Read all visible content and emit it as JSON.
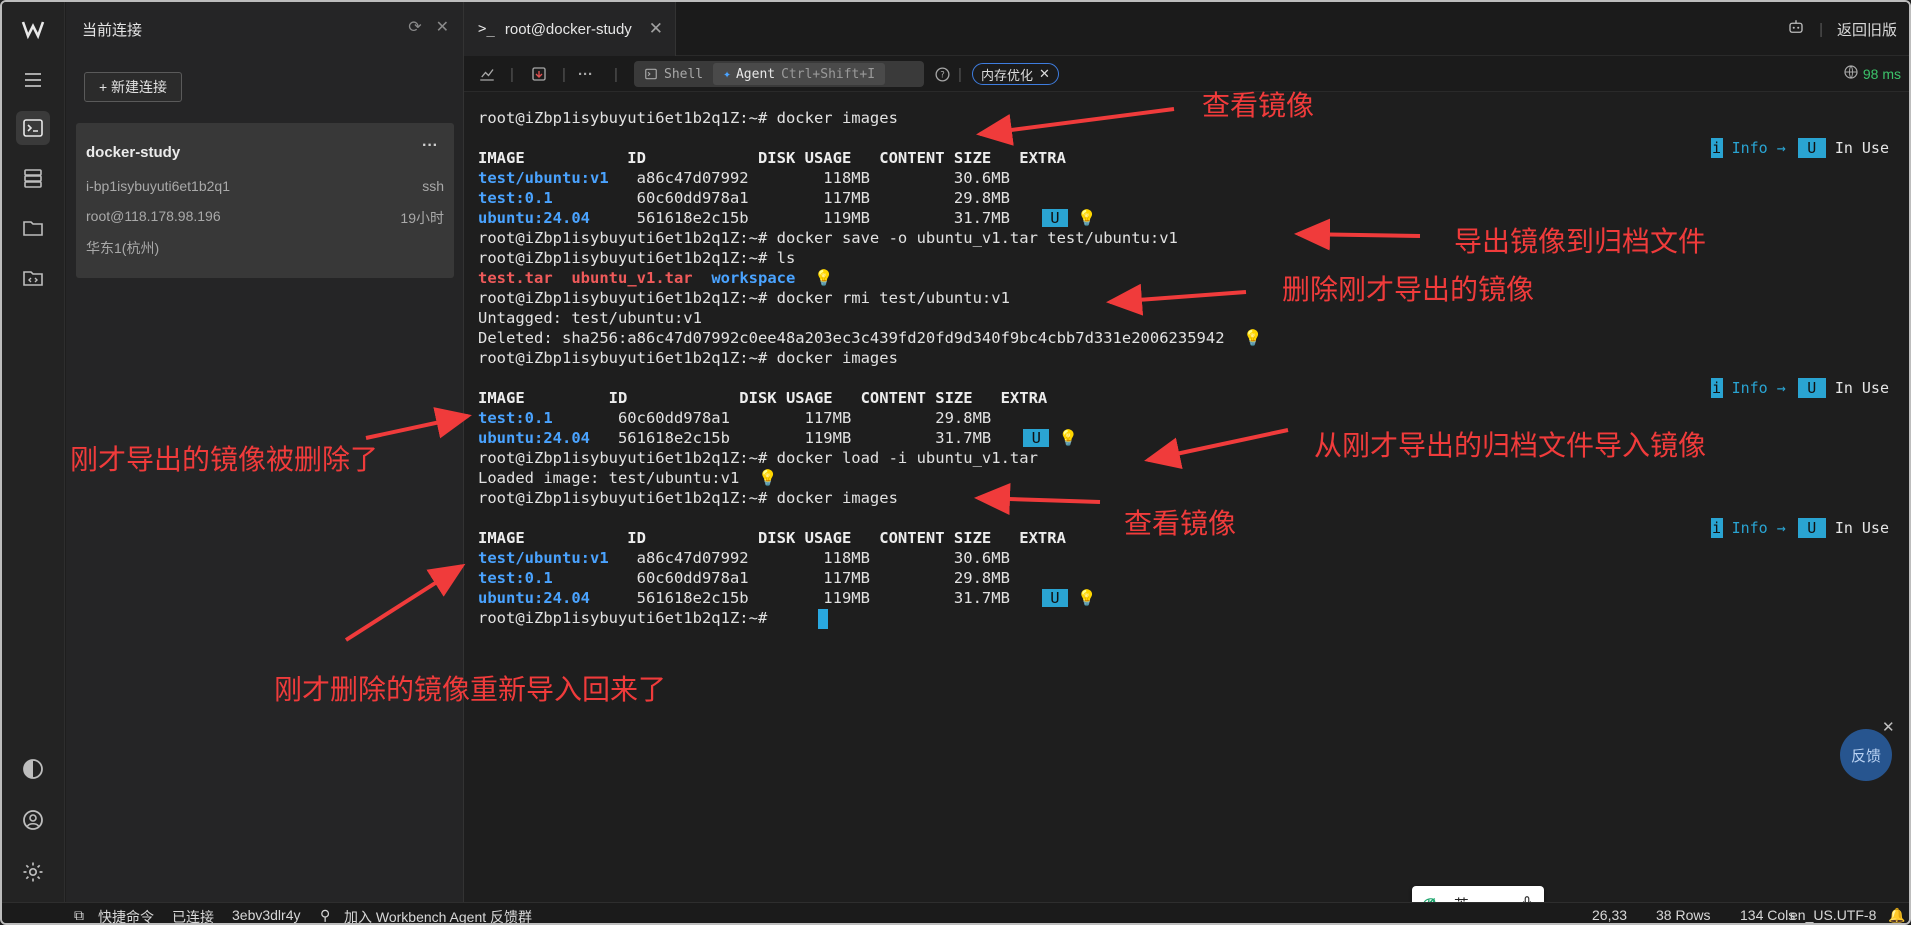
{
  "sidebar": {
    "title": "当前连接",
    "new_connection": "+ 新建连接",
    "card": {
      "name": "docker-study",
      "instance_id": "i-bp1isybuyuti6et1b2q1",
      "protocol": "ssh",
      "user_host": "root@118.178.98.196",
      "last_seen": "19小时",
      "region": "华东1(杭州)"
    }
  },
  "tab": {
    "label": "root@docker-study"
  },
  "top_right": {
    "legacy_link": "返回旧版"
  },
  "toolbar": {
    "shell_label": "Shell",
    "agent_label": "Agent",
    "agent_shortcut": "Ctrl+Shift+I",
    "memory_chip": "内存优化",
    "latency": "98 ms"
  },
  "terminal": {
    "lines": [
      "root@iZbp1isybuyuti6et1b2q1Z:~# docker images",
      "",
      "IMAGE           ID            DISK USAGE   CONTENT SIZE   EXTRA",
      "test/ubuntu:v1   a86c47d07992        118MB         30.6MB",
      "test:0.1         60c60dd978a1        117MB         29.8MB",
      "ubuntu:24.04     561618e2c15b        119MB         31.7MB",
      "root@iZbp1isybuyuti6et1b2q1Z:~# docker save -o ubuntu_v1.tar test/ubuntu:v1",
      "root@iZbp1isybuyuti6et1b2q1Z:~# ls",
      "test.tar  ubuntu_v1.tar  workspace",
      "root@iZbp1isybuyuti6et1b2q1Z:~# docker rmi test/ubuntu:v1",
      "Untagged: test/ubuntu:v1",
      "Deleted: sha256:a86c47d07992c0ee48a203ec3c439fd20fd9d340f9bc4cbb7d331e2006235942",
      "root@iZbp1isybuyuti6et1b2q1Z:~# docker images",
      "",
      "IMAGE         ID            DISK USAGE   CONTENT SIZE   EXTRA",
      "test:0.1       60c60dd978a1        117MB         29.8MB",
      "ubuntu:24.04   561618e2c15b        119MB         31.7MB",
      "root@iZbp1isybuyuti6et1b2q1Z:~# docker load -i ubuntu_v1.tar",
      "Loaded image: test/ubuntu:v1",
      "root@iZbp1isybuyuti6et1b2q1Z:~# docker images",
      "",
      "IMAGE           ID            DISK USAGE   CONTENT SIZE   EXTRA",
      "test/ubuntu:v1   a86c47d07992        118MB         30.6MB",
      "test:0.1         60c60dd978a1        117MB         29.8MB",
      "ubuntu:24.04     561618e2c15b        119MB         31.7MB",
      "root@iZbp1isybuyuti6et1b2q1Z:~# "
    ],
    "u_badge": "U",
    "info_badge": {
      "i": "i",
      "info": "Info →",
      "u": "U",
      "in_use": "In Use"
    }
  },
  "annotations": {
    "a1": "查看镜像",
    "a2": "导出镜像到归档文件",
    "a3": "删除刚才导出的镜像",
    "a4": "刚才导出的镜像被删除了",
    "a5": "从刚才导出的归档文件导入镜像",
    "a6": "查看镜像",
    "a7": "刚才删除的镜像重新导入回来了"
  },
  "feedback": "反馈",
  "ime": {
    "lang": "英",
    "punct": "·,"
  },
  "statusbar": {
    "quick_cmd": "快捷命令",
    "connected": "已连接",
    "session": "3ebv3dlr4y",
    "join_group": "加入 Workbench Agent 反馈群",
    "cursor_pos": "26,33",
    "rows": "38 Rows",
    "cols": "134 Cols",
    "encoding": "en_US.UTF-8"
  },
  "colors": {
    "accent": "#2aa4d2",
    "annotation": "#f03b3b",
    "link_blue": "#4aa3ff",
    "file_red": "#f05a5a",
    "latency_green": "#3cc36a"
  }
}
